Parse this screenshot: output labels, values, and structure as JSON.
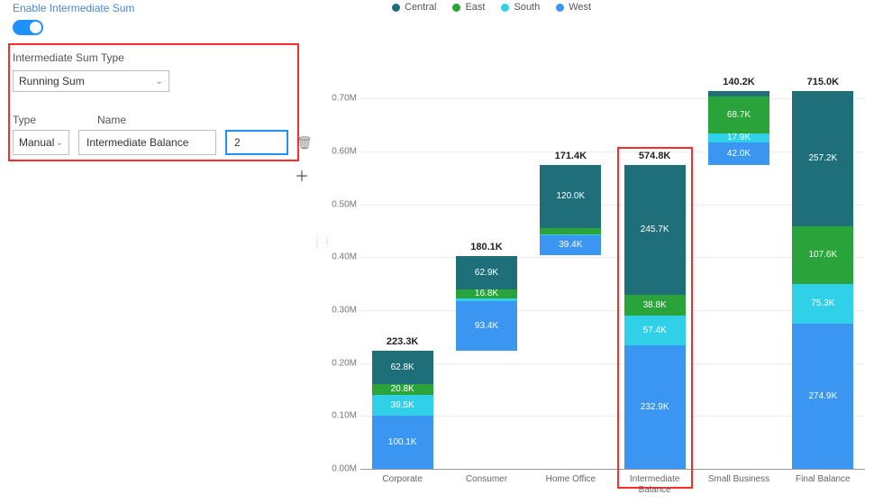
{
  "panel": {
    "title": "Enable Intermediate Sum",
    "sum_type_label": "Intermediate Sum Type",
    "sum_type_value": "Running Sum",
    "type_label": "Type",
    "name_label": "Name",
    "type_value": "Manual",
    "name_value": "Intermediate Balance",
    "position_value": "2"
  },
  "legend": {
    "items": [
      {
        "label": "Central",
        "color": "#1f6f7a"
      },
      {
        "label": "East",
        "color": "#2aa33a"
      },
      {
        "label": "South",
        "color": "#2fd0e8"
      },
      {
        "label": "West",
        "color": "#3a96f0"
      }
    ]
  },
  "chart_data": {
    "type": "bar",
    "stacked": true,
    "waterfall_like": true,
    "ylabel": "",
    "xlabel": "",
    "ylim": [
      0,
      0.75
    ],
    "y_ticks": [
      "0.00M",
      "0.10M",
      "0.20M",
      "0.30M",
      "0.40M",
      "0.50M",
      "0.60M",
      "0.70M"
    ],
    "unit_note": "values in K; bar heights stack on running baseline; *_balance bars start at 0",
    "series_order": [
      "West",
      "South",
      "East",
      "Central"
    ],
    "colors": {
      "Central": "#1f6f7a",
      "East": "#2aa33a",
      "South": "#2fd0e8",
      "West": "#3a96f0"
    },
    "categories": [
      {
        "name": "Corporate",
        "total_label": "223.3K",
        "base_k": 0,
        "segments": {
          "West": 100.1,
          "South": 39.5,
          "East": 20.8,
          "Central": 62.8
        }
      },
      {
        "name": "Consumer",
        "total_label": "180.1K",
        "base_k": 223.3,
        "segments": {
          "West": 93.4,
          "South": 6.0,
          "East": 16.8,
          "Central": 62.9
        }
      },
      {
        "name": "Home Office",
        "total_label": "171.4K",
        "base_k": 403.4,
        "segments": {
          "West": 39.4,
          "South": 1.2,
          "East": 10.8,
          "Central": 120.0
        }
      },
      {
        "name": "Intermediate Balance",
        "total_label": "574.8K",
        "base_k": 0,
        "segments": {
          "West": 232.9,
          "South": 57.4,
          "East": 38.8,
          "Central": 245.7
        }
      },
      {
        "name": "Small Business",
        "total_label": "140.2K",
        "base_k": 574.8,
        "segments": {
          "West": 42.0,
          "South": 17.9,
          "East": 68.7,
          "Central": 11.5
        }
      },
      {
        "name": "Final Balance",
        "total_label": "715.0K",
        "base_k": 0,
        "segments": {
          "West": 274.9,
          "South": 75.3,
          "East": 107.6,
          "Central": 257.2
        }
      }
    ],
    "highlighted_category": "Intermediate Balance"
  }
}
